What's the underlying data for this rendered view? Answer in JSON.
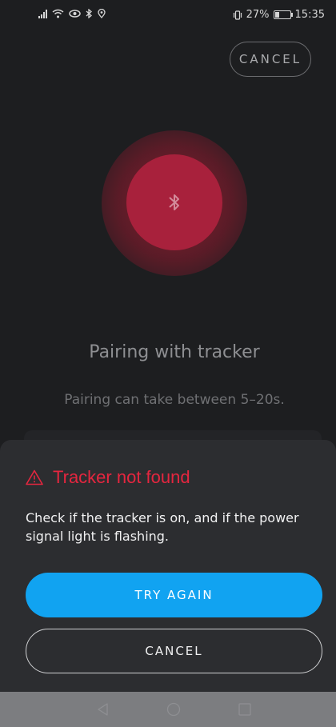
{
  "status_bar": {
    "battery_percent": "27%",
    "time": "15:35",
    "icons": [
      "signal-icon",
      "wifi-icon",
      "eye-icon",
      "bluetooth-icon",
      "location-icon",
      "vibrate-icon",
      "battery-icon"
    ]
  },
  "header": {
    "cancel_label": "CANCEL"
  },
  "pairing": {
    "icon": "bluetooth-icon",
    "title": "Pairing with tracker",
    "subtitle": "Pairing can take between 5–20s."
  },
  "sheet": {
    "icon": "warning-icon",
    "title": "Tracker not found",
    "message": "Check if the tracker is on, and if the power signal light is flashing.",
    "primary_label": "TRY AGAIN",
    "secondary_label": "CANCEL"
  },
  "colors": {
    "background": "#1d1e20",
    "sheet": "#2c2d30",
    "error": "#e5263f",
    "primary": "#11a3f1",
    "pulse": "#a8213c",
    "nav_bar": "#7c7d80"
  },
  "battery_level": 0.27
}
